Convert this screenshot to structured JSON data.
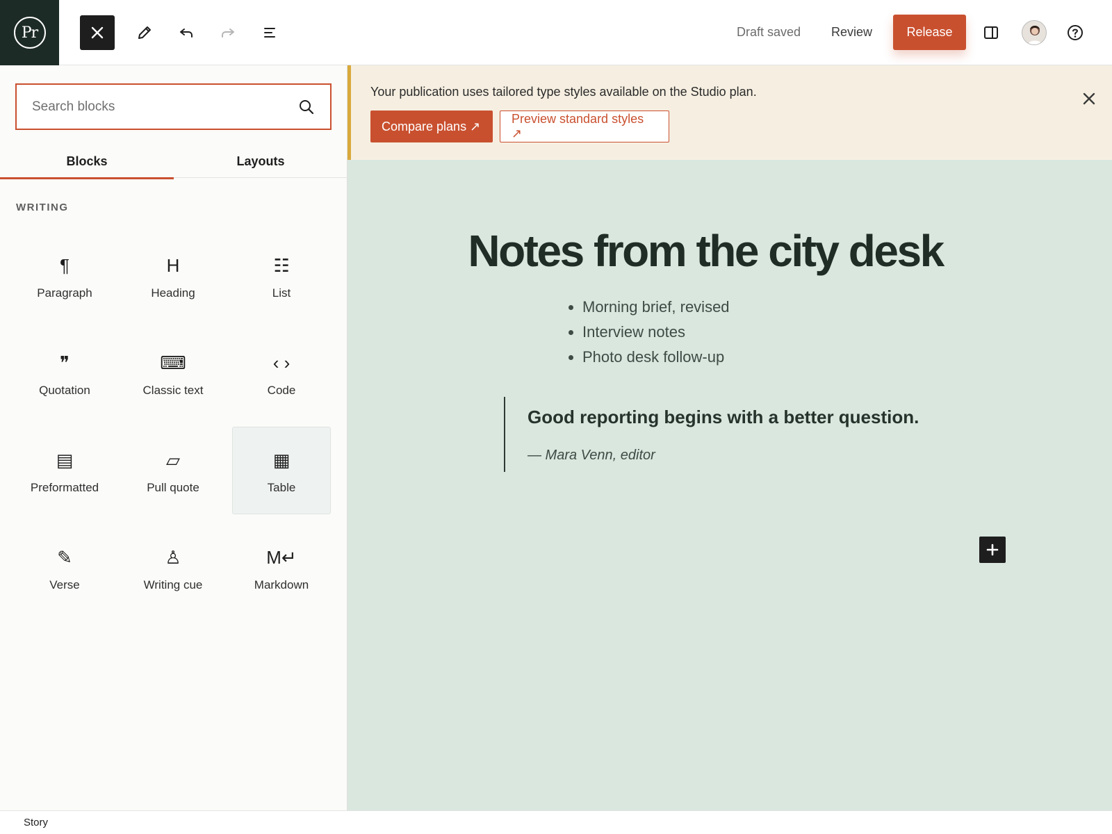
{
  "app": {
    "logo_text": "Pr"
  },
  "toolbar": {
    "icons": [
      "close-icon",
      "pencil-icon",
      "undo-icon",
      "redo-icon",
      "list-view-icon",
      "sidebar-toggle-icon",
      "help-icon"
    ],
    "draft_status": "Draft saved",
    "review_label": "Review",
    "release_label": "Release"
  },
  "inserter": {
    "search_placeholder": "Search blocks",
    "tabs": [
      {
        "label": "Blocks",
        "active": true
      },
      {
        "label": "Layouts",
        "active": false
      }
    ],
    "section_label": "WRITING",
    "blocks": [
      {
        "label": "Paragraph",
        "glyph": "¶",
        "icon": "paragraph-icon"
      },
      {
        "label": "Heading",
        "glyph": "H",
        "icon": "heading-icon"
      },
      {
        "label": "List",
        "glyph": "☷",
        "icon": "list-icon"
      },
      {
        "label": "Quotation",
        "glyph": "❞",
        "icon": "quote-icon"
      },
      {
        "label": "Classic text",
        "glyph": "⌨",
        "icon": "keyboard-icon"
      },
      {
        "label": "Code",
        "glyph": "‹ ›",
        "icon": "code-icon"
      },
      {
        "label": "Preformatted",
        "glyph": "▤",
        "icon": "preformatted-icon"
      },
      {
        "label": "Pull quote",
        "glyph": "▱",
        "icon": "pullquote-icon"
      },
      {
        "label": "Table",
        "glyph": "▦",
        "icon": "table-icon",
        "selected": true
      },
      {
        "label": "Verse",
        "glyph": "✎",
        "icon": "verse-icon"
      },
      {
        "label": "Writing cue",
        "glyph": "♙",
        "icon": "writing-cue-icon"
      },
      {
        "label": "Markdown",
        "glyph": "M↵",
        "icon": "markdown-icon"
      }
    ]
  },
  "notice": {
    "text": "Your publication uses tailored type styles available on the Studio plan.",
    "primary_label": "Compare plans ↗",
    "secondary_label": "Preview standard styles ↗"
  },
  "post": {
    "title": "Notes from the city desk",
    "list_items": [
      "Morning brief, revised",
      "Interview notes",
      "Photo desk follow-up"
    ],
    "quote_text": "Good reporting begins with a better question.",
    "quote_cite": "— Mara Venn, editor"
  },
  "footer": {
    "breadcrumb": "Story"
  },
  "colors": {
    "accent": "#c9502f",
    "dark": "#1e1e1e",
    "canvas": "#d9e7df",
    "notice": "#f6efe1",
    "notice_border": "#d9a93b"
  }
}
